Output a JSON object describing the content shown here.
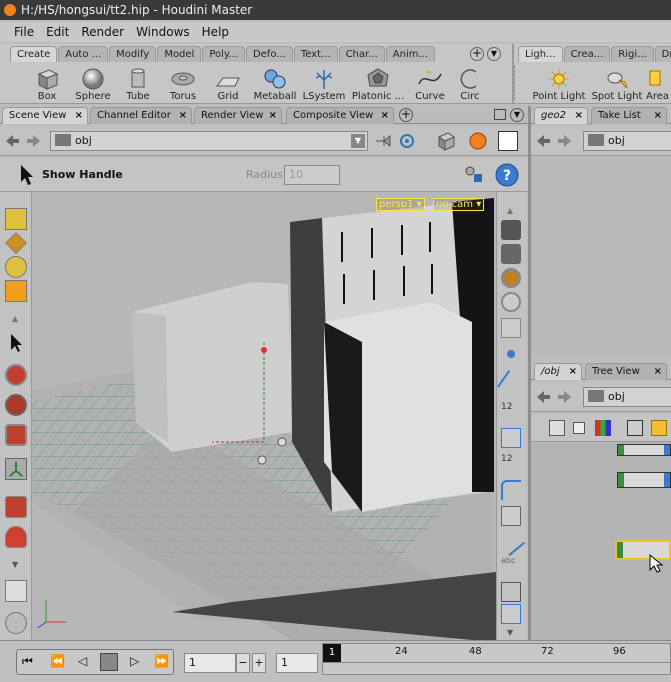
{
  "window": {
    "title": "H:/HS/hongsui/tt2.hip - Houdini Master"
  },
  "menu": [
    "File",
    "Edit",
    "Render",
    "Windows",
    "Help"
  ],
  "shelf_left": {
    "tabs": [
      "Create",
      "Auto ...",
      "Modify",
      "Model",
      "Poly...",
      "Defo...",
      "Text...",
      "Char...",
      "Anim..."
    ],
    "tools": [
      {
        "label": "Box",
        "icon": "box-icon"
      },
      {
        "label": "Sphere",
        "icon": "sphere-icon"
      },
      {
        "label": "Tube",
        "icon": "tube-icon"
      },
      {
        "label": "Torus",
        "icon": "torus-icon"
      },
      {
        "label": "Grid",
        "icon": "grid-icon"
      },
      {
        "label": "Metaball",
        "icon": "metaball-icon"
      },
      {
        "label": "LSystem",
        "icon": "lsystem-icon"
      },
      {
        "label": "Platonic ...",
        "icon": "platonic-icon"
      },
      {
        "label": "Curve",
        "icon": "curve-icon"
      },
      {
        "label": "Circ",
        "icon": "circle-icon"
      }
    ]
  },
  "shelf_right": {
    "tabs": [
      "Ligh...",
      "Crea...",
      "Rigi...",
      "Dr"
    ],
    "tools": [
      {
        "label": "Point Light",
        "icon": "point-light-icon"
      },
      {
        "label": "Spot Light",
        "icon": "spot-light-icon"
      },
      {
        "label": "Area",
        "icon": "area-light-icon"
      }
    ]
  },
  "left_panel": {
    "tabs": [
      "Scene View",
      "Channel Editor",
      "Render View",
      "Composite View"
    ],
    "path": "obj"
  },
  "operation": {
    "show_handle": "Show Handle",
    "radius_label": "Radius",
    "radius_value": "10"
  },
  "viewport": {
    "camera": "persp1",
    "cam_menu": "no cam"
  },
  "right_top": {
    "tabs": [
      "geo2",
      "Take List"
    ],
    "path": "obj"
  },
  "right_bottom": {
    "tabs": [
      "/obj",
      "Tree View"
    ],
    "path": "obj"
  },
  "timeline": {
    "frame": "1",
    "step": "1",
    "ticks": [
      "1",
      "24",
      "48",
      "72",
      "96"
    ],
    "current_frame_marker": "1"
  },
  "colors": {
    "accent": "#f08020",
    "handle": "#ffe34a",
    "node_green": "#3a8c3a"
  }
}
